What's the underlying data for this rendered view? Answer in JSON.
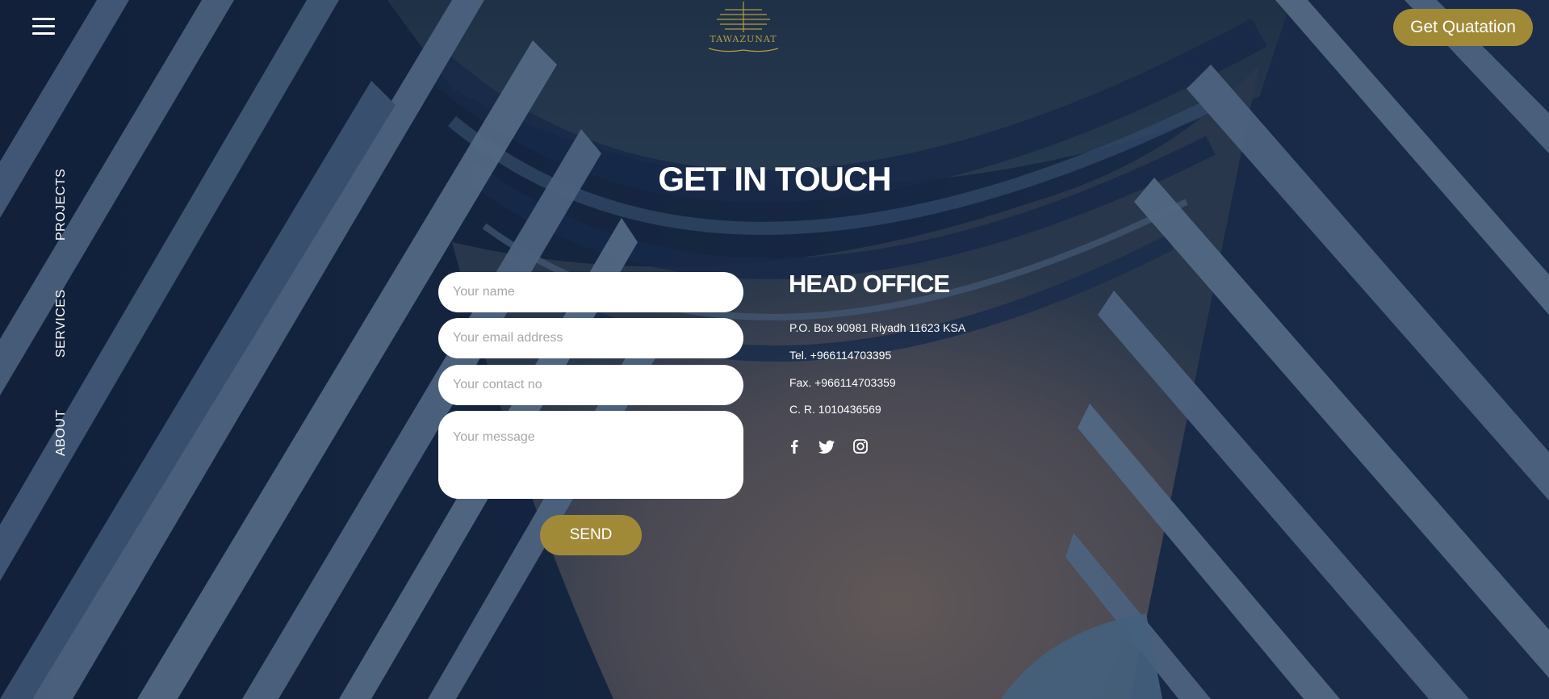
{
  "header": {
    "logo_text": "TAWAZUNAT",
    "quote_button_label": "Get Quatation"
  },
  "side_nav": {
    "items": [
      {
        "label": "PROJECTS"
      },
      {
        "label": "SERVICES"
      },
      {
        "label": "ABOUT"
      }
    ]
  },
  "contact": {
    "title": "GET IN TOUCH",
    "form": {
      "name_placeholder": "Your name",
      "email_placeholder": "Your email address",
      "contact_placeholder": "Your contact no",
      "message_placeholder": "Your message",
      "send_label": "SEND"
    },
    "head_office": {
      "title": "HEAD OFFICE",
      "address": "P.O. Box 90981 Riyadh 11623 KSA",
      "tel": "Tel. +966114703395",
      "fax": "Fax. +966114703359",
      "cr": "C. R. 1010436569"
    },
    "social_icons": [
      "facebook-icon",
      "twitter-icon",
      "instagram-icon"
    ]
  },
  "colors": {
    "accent_gold": "#a08a38",
    "background_navy": "#1d3050",
    "text_white": "#ffffff"
  }
}
